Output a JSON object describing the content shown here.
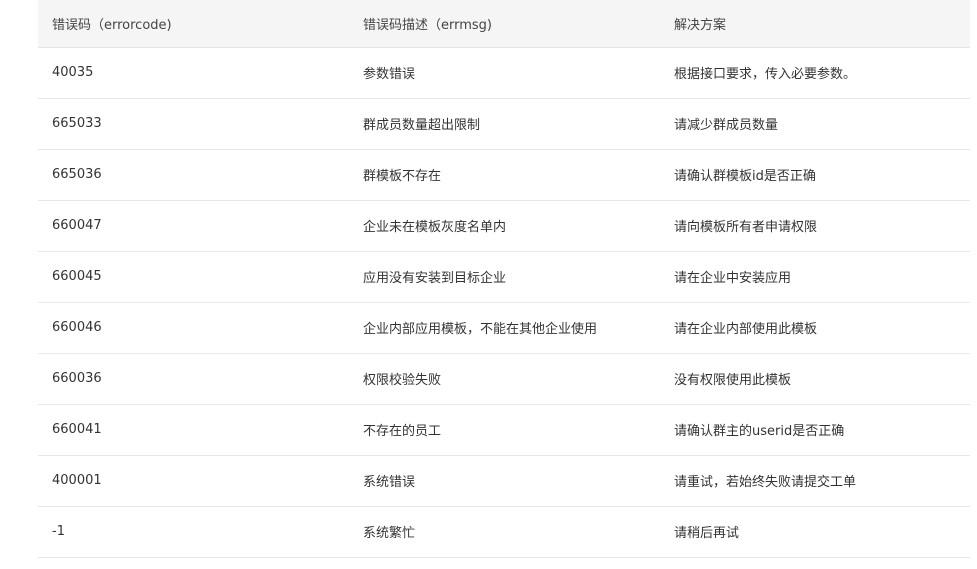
{
  "table": {
    "headers": [
      "错误码（errorcode)",
      "错误码描述（errmsg)",
      "解决方案"
    ],
    "rows": [
      [
        "40035",
        "参数错误",
        "根据接口要求，传入必要参数。"
      ],
      [
        "665033",
        "群成员数量超出限制",
        "请减少群成员数量"
      ],
      [
        "665036",
        "群模板不存在",
        "请确认群模板id是否正确"
      ],
      [
        "660047",
        "企业未在模板灰度名单内",
        "请向模板所有者申请权限"
      ],
      [
        "660045",
        "应用没有安装到目标企业",
        "请在企业中安装应用"
      ],
      [
        "660046",
        "企业内部应用模板，不能在其他企业使用",
        "请在企业内部使用此模板"
      ],
      [
        "660036",
        "权限校验失败",
        "没有权限使用此模板"
      ],
      [
        "660041",
        "不存在的员工",
        "请确认群主的userid是否正确"
      ],
      [
        "400001",
        "系统错误",
        "请重试，若始终失败请提交工单"
      ],
      [
        "-1",
        "系统繁忙",
        "请稍后再试"
      ]
    ]
  }
}
